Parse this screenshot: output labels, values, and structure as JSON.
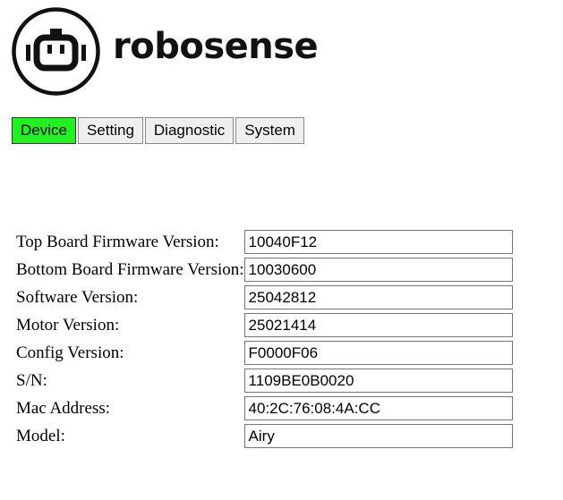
{
  "brand": {
    "name": "robosense",
    "accent_color": "#e4241f"
  },
  "tabs": [
    {
      "label": "Device",
      "active": true,
      "color": "#21f121"
    },
    {
      "label": "Setting",
      "active": false
    },
    {
      "label": "Diagnostic",
      "active": false
    },
    {
      "label": "System",
      "active": false
    }
  ],
  "device_info": [
    {
      "label": "Top Board Firmware Version:",
      "value": "10040F12"
    },
    {
      "label": "Bottom Board Firmware Version:",
      "value": "10030600"
    },
    {
      "label": "Software Version:",
      "value": "25042812"
    },
    {
      "label": "Motor Version:",
      "value": "25021414"
    },
    {
      "label": "Config Version:",
      "value": "F0000F06"
    },
    {
      "label": "S/N:",
      "value": "1109BE0B0020"
    },
    {
      "label": "Mac Address:",
      "value": "40:2C:76:08:4A:CC"
    },
    {
      "label": "Model:",
      "value": "Airy"
    }
  ]
}
